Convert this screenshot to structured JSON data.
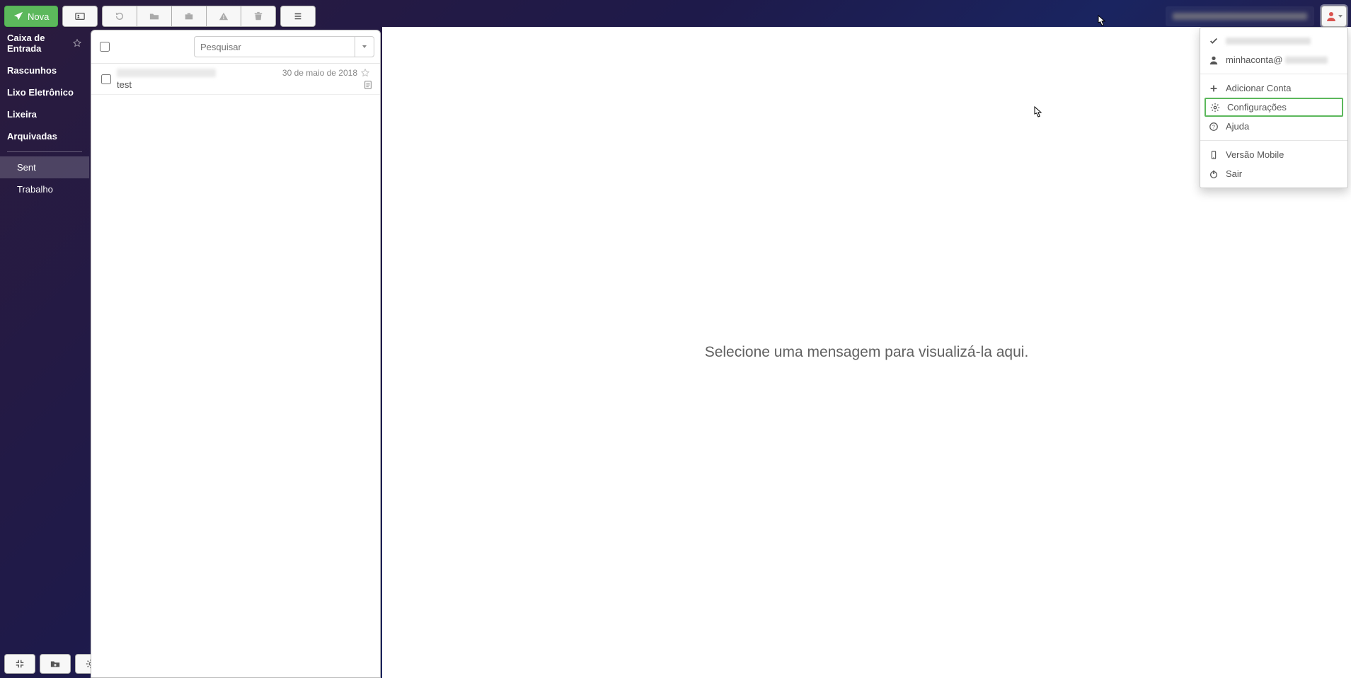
{
  "toolbar": {
    "compose_label": "Nova"
  },
  "sidebar": {
    "system_folders": [
      {
        "label": "Caixa de Entrada",
        "has_star": true
      },
      {
        "label": "Rascunhos"
      },
      {
        "label": "Lixo Eletrônico"
      },
      {
        "label": "Lixeira"
      },
      {
        "label": "Arquivadas"
      }
    ],
    "custom_folders": [
      {
        "label": "Sent",
        "selected": true
      },
      {
        "label": "Trabalho",
        "selected": false
      }
    ]
  },
  "list": {
    "search_placeholder": "Pesquisar",
    "messages": [
      {
        "subject": "test",
        "date": "30 de maio de 2018",
        "has_attachment": true
      }
    ]
  },
  "preview": {
    "placeholder": "Selecione uma mensagem para visualizá-la aqui."
  },
  "user_menu": {
    "current_account": "minhaconta@",
    "add_account": "Adicionar Conta",
    "settings": "Configurações",
    "help": "Ajuda",
    "mobile": "Versão Mobile",
    "logout": "Sair"
  },
  "colors": {
    "accent": "#5cb85c"
  }
}
